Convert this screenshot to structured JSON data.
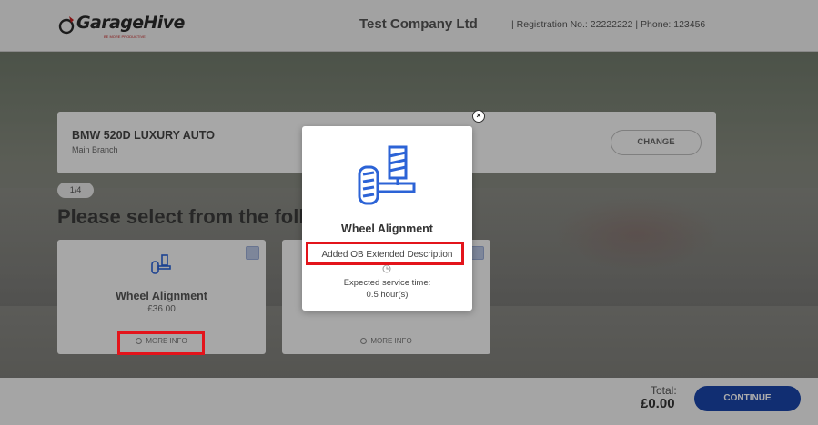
{
  "header": {
    "logo_text": "GarageHive",
    "logo_tagline": "BE MORE PRODUCTIVE",
    "company": "Test Company Ltd",
    "registration_info": "|  Registration No.: 22222222  |  Phone: 123456"
  },
  "vehicle": {
    "name": "BMW 520D LUXURY AUTO",
    "branch": "Main Branch",
    "change_label": "CHANGE"
  },
  "step": "1/4",
  "headline": "Please select from the following",
  "services": [
    {
      "title": "Wheel Alignment",
      "price": "£36.00",
      "more_info": "MORE INFO"
    },
    {
      "title": "",
      "price": "",
      "more_info": "MORE INFO"
    }
  ],
  "modal": {
    "title": "Wheel Alignment",
    "description": "Added OB Extended Description",
    "time_label": "Expected service time:",
    "time_value": "0.5 hour(s)",
    "close_symbol": "×"
  },
  "footer": {
    "total_label": "Total:",
    "total_value": "£0.00",
    "continue_label": "CONTINUE"
  },
  "colors": {
    "accent": "#1a45a8",
    "highlight": "#e3141b",
    "icon_blue": "#2c63d6"
  },
  "icons": [
    "wheel-alignment-icon",
    "clock-icon",
    "close-icon",
    "info-icon"
  ]
}
